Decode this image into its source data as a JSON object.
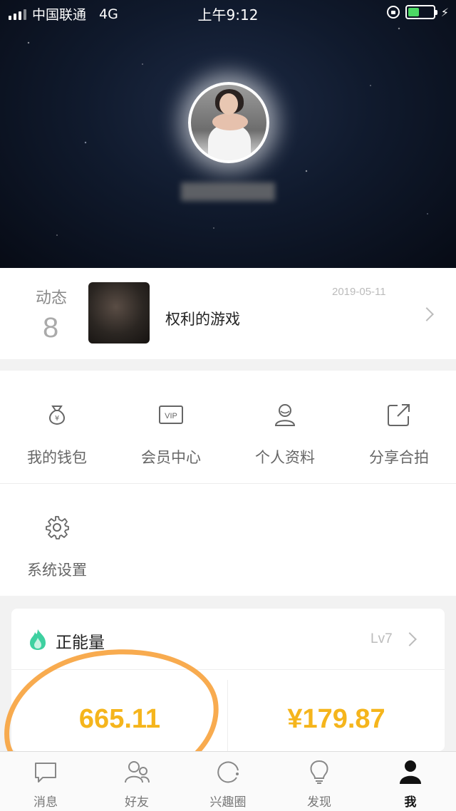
{
  "status_bar": {
    "carrier": "中国联通",
    "network": "4G",
    "time": "上午9:12",
    "battery_color": "#4cd964"
  },
  "profile": {
    "avatar_icon": "avatar-photo"
  },
  "dynamic": {
    "label": "动态",
    "count": "8",
    "title": "权利的游戏",
    "date": "2019-05-11"
  },
  "menu": {
    "items": [
      {
        "label": "我的钱包",
        "icon": "money-bag-icon"
      },
      {
        "label": "会员中心",
        "icon": "vip-icon"
      },
      {
        "label": "个人资料",
        "icon": "person-icon"
      },
      {
        "label": "分享合拍",
        "icon": "share-icon"
      },
      {
        "label": "系统设置",
        "icon": "gear-icon"
      }
    ]
  },
  "energy": {
    "title": "正能量",
    "level": "Lv7",
    "value": "665.11",
    "money": "¥179.87",
    "accent_color": "#f5b51c"
  },
  "tabbar": {
    "tabs": [
      {
        "label": "消息",
        "icon": "message-icon"
      },
      {
        "label": "好友",
        "icon": "friends-icon"
      },
      {
        "label": "兴趣圈",
        "icon": "interest-circle-icon"
      },
      {
        "label": "发现",
        "icon": "lightbulb-icon"
      },
      {
        "label": "我",
        "icon": "me-icon"
      }
    ],
    "active": "我"
  }
}
